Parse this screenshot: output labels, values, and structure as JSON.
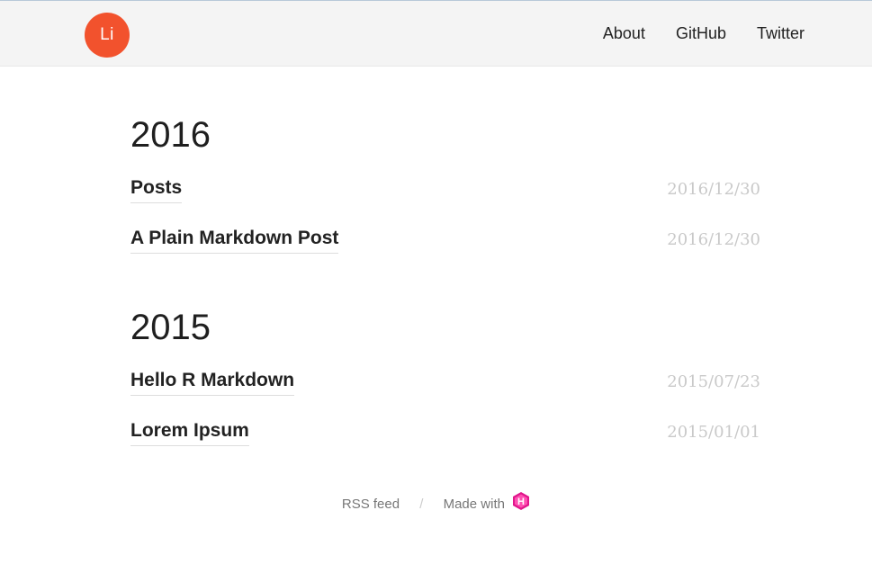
{
  "header": {
    "logo_text": "Li",
    "nav": [
      {
        "label": "About"
      },
      {
        "label": "GitHub"
      },
      {
        "label": "Twitter"
      }
    ]
  },
  "archive": [
    {
      "year": "2016",
      "posts": [
        {
          "title": "Posts",
          "date": "2016/12/30"
        },
        {
          "title": "A Plain Markdown Post",
          "date": "2016/12/30"
        }
      ]
    },
    {
      "year": "2015",
      "posts": [
        {
          "title": "Hello R Markdown",
          "date": "2015/07/23"
        },
        {
          "title": "Lorem Ipsum",
          "date": "2015/01/01"
        }
      ]
    }
  ],
  "footer": {
    "rss_label": "RSS feed",
    "separator": "/",
    "made_with_label": "Made with",
    "icon": "hugo-logo-icon",
    "icon_color": "#e0168b"
  },
  "colors": {
    "logo_bg": "#f2522d",
    "header_bg": "#f4f4f4",
    "date_color": "#c9c9c9"
  }
}
